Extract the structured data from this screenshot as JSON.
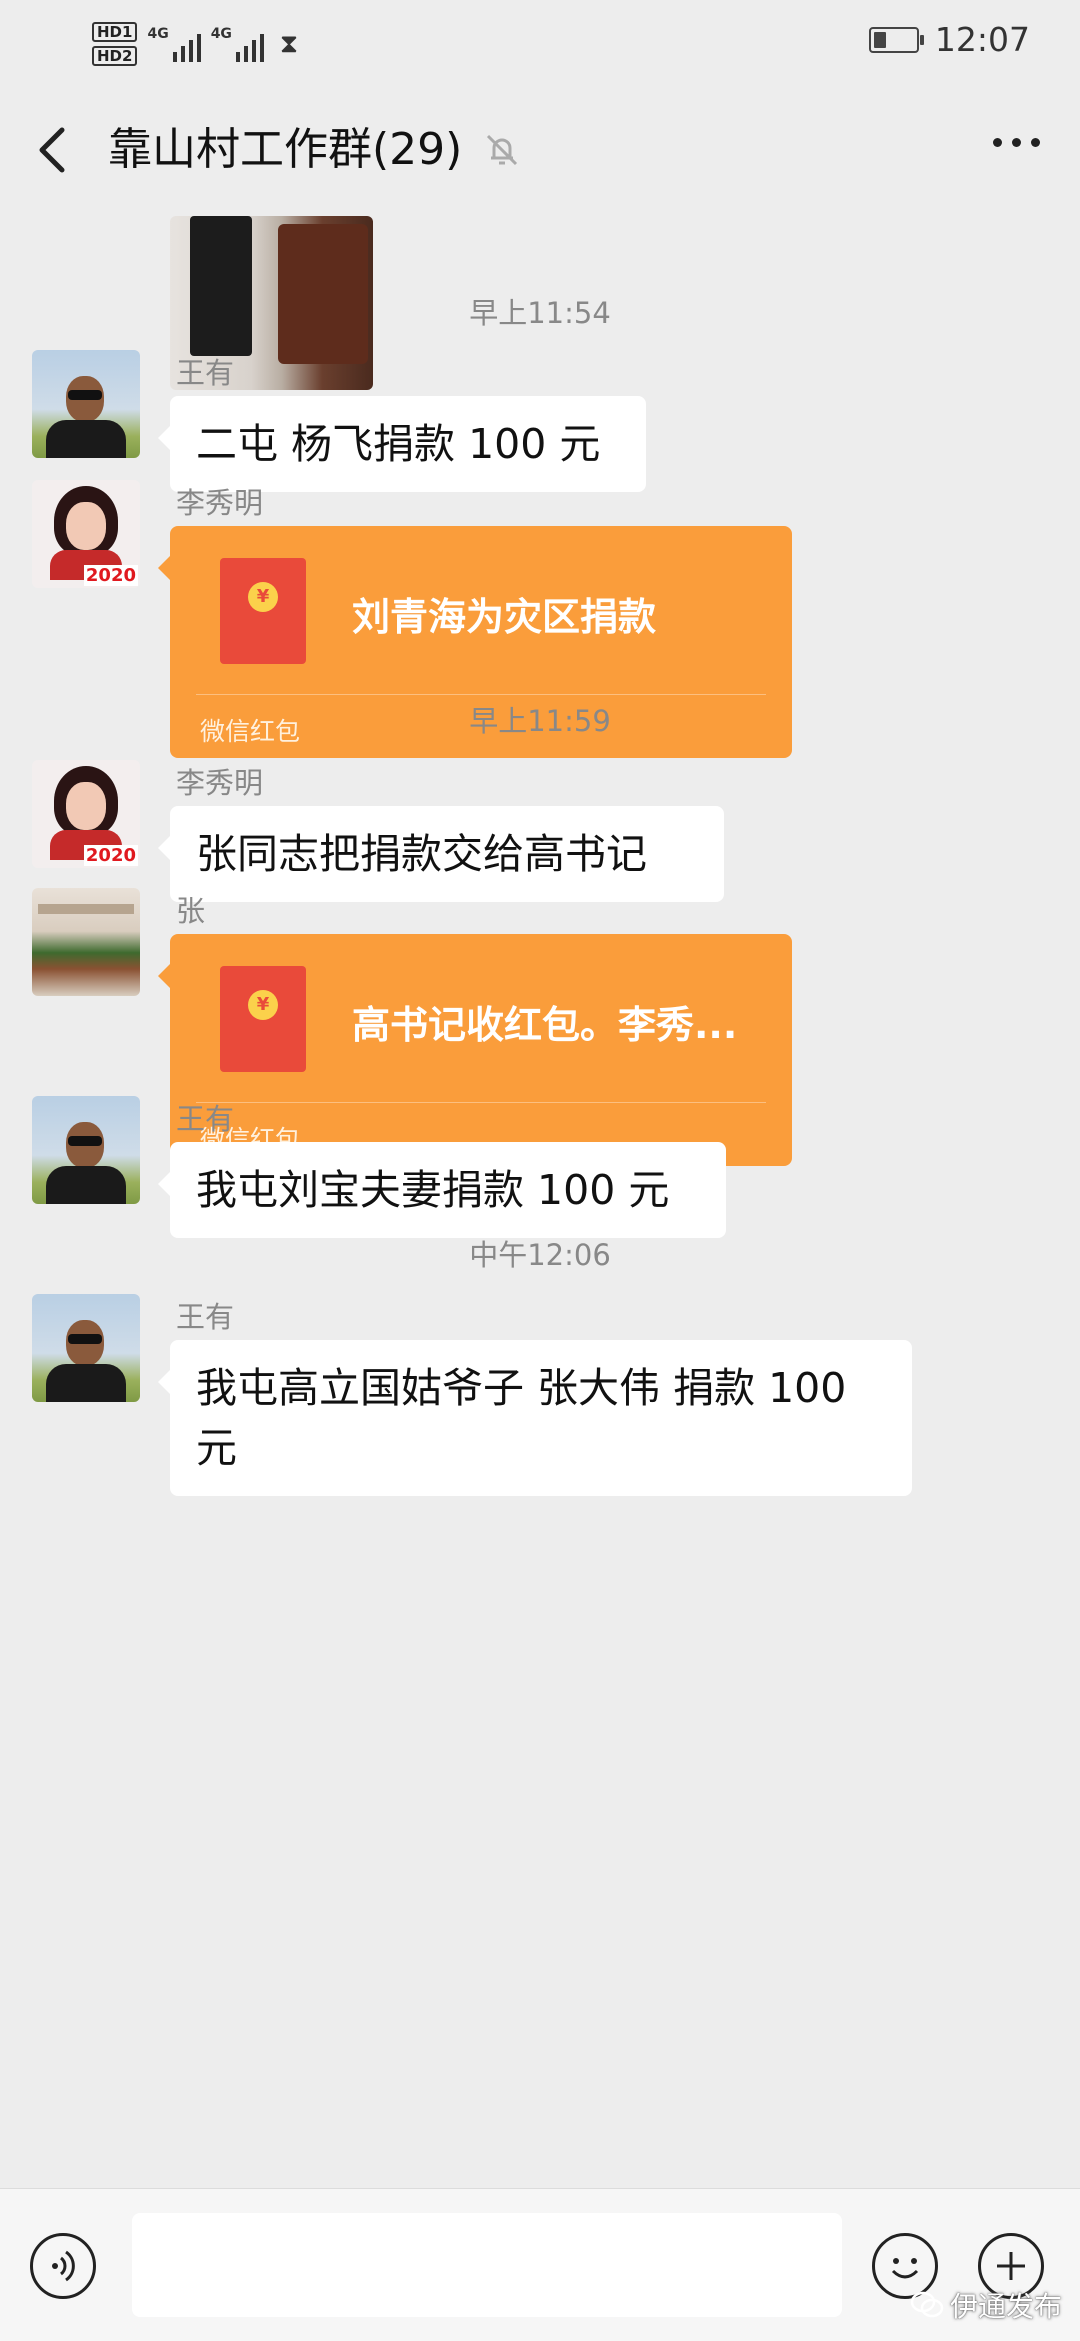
{
  "status_bar": {
    "sim1": "HD1",
    "sim2": "HD2",
    "network1": "4G",
    "network2": "4G",
    "time": "12:07",
    "battery_level": 0.3
  },
  "header": {
    "title": "靠山村工作群(29)",
    "muted": true
  },
  "timestamps": [
    "早上11:54",
    "早上11:59",
    "中午12:06"
  ],
  "messages": [
    {
      "sender": "王有",
      "text": "二屯 杨飞捐款 100 元"
    },
    {
      "sender": "李秀明",
      "red_packet_title": "刘青海为灾区捐款",
      "red_packet_label": "微信红包",
      "avatar_text": "2020"
    },
    {
      "sender": "李秀明",
      "text": "张同志把捐款交给高书记",
      "avatar_text": "2020"
    },
    {
      "sender": "张",
      "red_packet_title": "高书记收红包。李秀...",
      "red_packet_label": "微信红包"
    },
    {
      "sender": "王有",
      "text": "我屯刘宝夫妻捐款 100 元"
    },
    {
      "sender": "王有",
      "text_line1": "我屯高立国姑爷子 张大伟 捐款 100",
      "text_line2": "元"
    }
  ],
  "watermark": "伊通发布",
  "colors": {
    "background": "#ededed",
    "red_packet": "#fa9d3b",
    "bubble": "#ffffff"
  }
}
